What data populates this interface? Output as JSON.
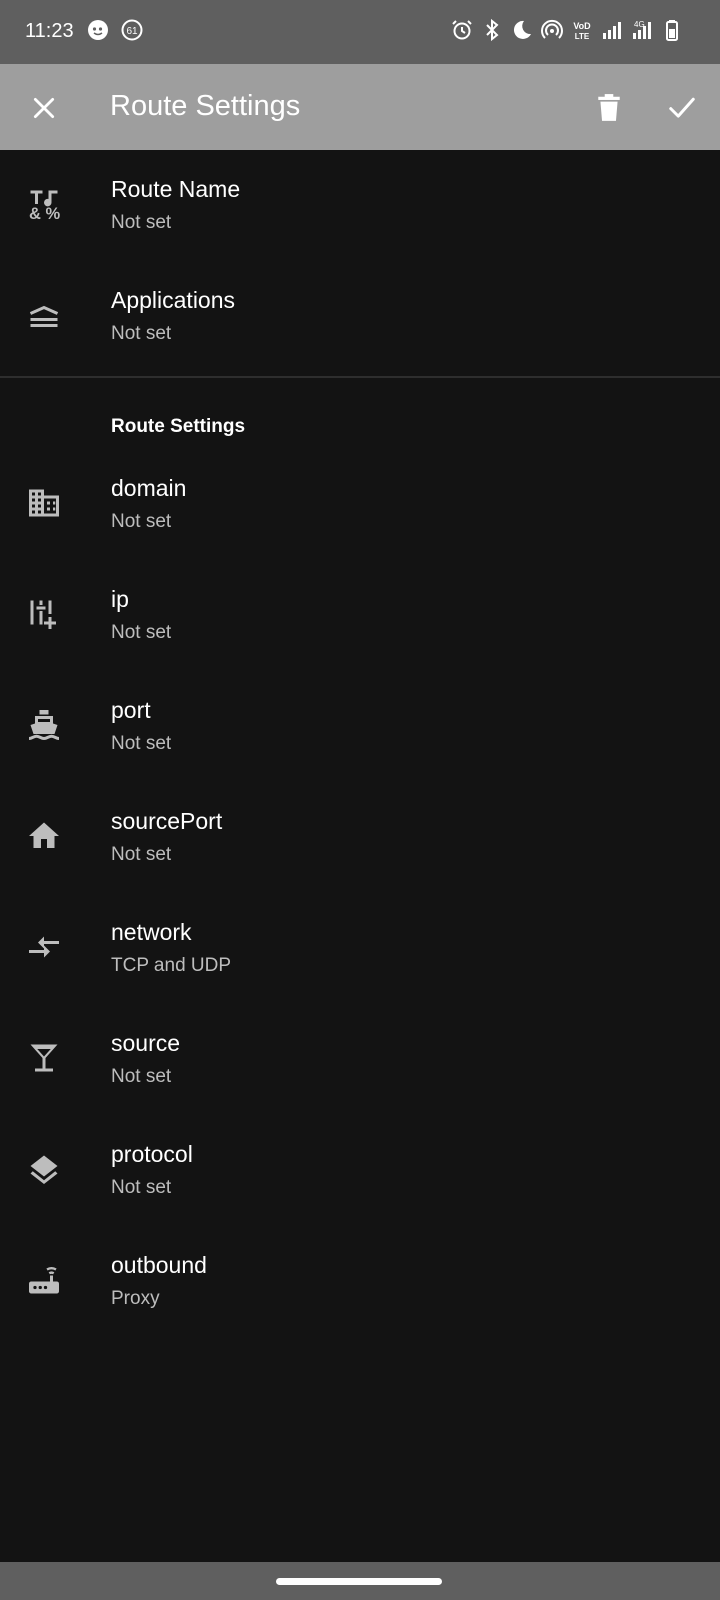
{
  "status": {
    "time": "11:23",
    "left_icons": [
      "chat-bubble-icon",
      "notification-count-icon"
    ],
    "right_icons": [
      "alarm-icon",
      "bluetooth-icon",
      "do-not-disturb-moon-icon",
      "hotspot-icon",
      "volte-icon",
      "signal-icon",
      "signal-4g-icon",
      "battery-icon"
    ],
    "volte_text": "VoLTE",
    "network_text": "4G",
    "notification_count": "61"
  },
  "appbar": {
    "title": "Route Settings",
    "close_icon": "close-icon",
    "delete_icon": "delete-icon",
    "confirm_icon": "check-icon"
  },
  "items_top": [
    {
      "title": "Route Name",
      "value": "Not set",
      "icon": "text-format-icon"
    },
    {
      "title": "Applications",
      "value": "Not set",
      "icon": "layers-lines-icon"
    }
  ],
  "section": {
    "title": "Route Settings"
  },
  "items": [
    {
      "title": "domain",
      "value": "Not set",
      "icon": "building-icon"
    },
    {
      "title": "ip",
      "value": "Not set",
      "icon": "sliders-add-icon"
    },
    {
      "title": "port",
      "value": "Not set",
      "icon": "ship-icon"
    },
    {
      "title": "sourcePort",
      "value": "Not set",
      "icon": "home-icon"
    },
    {
      "title": "network",
      "value": "TCP and UDP",
      "icon": "compare-arrows-icon"
    },
    {
      "title": "source",
      "value": "Not set",
      "icon": "cocktail-glass-icon"
    },
    {
      "title": "protocol",
      "value": "Not set",
      "icon": "layers-icon"
    },
    {
      "title": "outbound",
      "value": "Proxy",
      "icon": "router-icon"
    }
  ],
  "colors": {
    "background": "#131313",
    "appbar": "#9e9e9e",
    "statusbar": "#5f5f5f",
    "subtitle": "#bdbdbd",
    "icon": "#bdbdbd"
  }
}
